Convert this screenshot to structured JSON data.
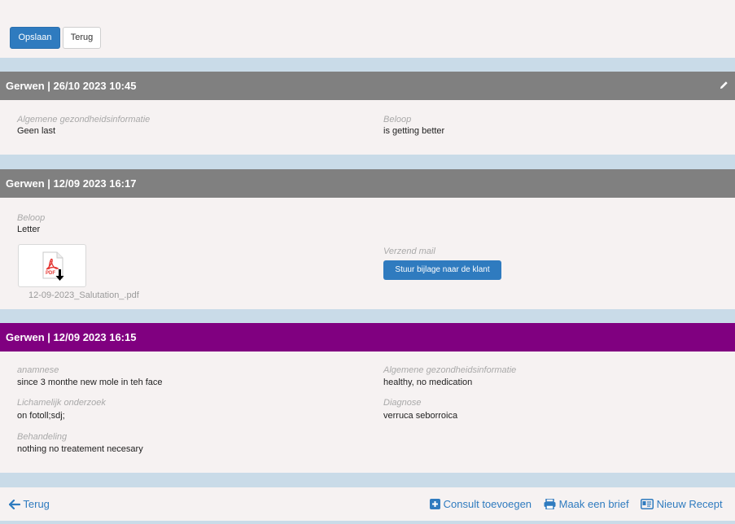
{
  "toolbar": {
    "save_label": "Opslaan",
    "back_label": "Terug"
  },
  "entries": [
    {
      "header": "Gerwen | 26/10 2023 10:45",
      "fields": [
        {
          "label": "Algemene gezondheidsinformatie",
          "value": "Geen last"
        },
        {
          "label": "Beloop",
          "value": "is getting better"
        }
      ]
    },
    {
      "header": "Gerwen | 12/09 2023 16:17",
      "fields": [
        {
          "label": "Beloop",
          "value": "Letter"
        },
        {
          "label": "Verzend mail",
          "value": ""
        }
      ],
      "attachment": {
        "file_name": "12-09-2023_Salutation_.pdf",
        "icon_text": "PDF",
        "icon": "pdf-download-icon"
      },
      "send_button_label": "Stuur bijlage naar de klant"
    },
    {
      "header": "Gerwen | 12/09 2023 16:15",
      "fields": [
        {
          "label": "anamnese",
          "value": "since 3 monthe new mole in teh face"
        },
        {
          "label": "Algemene gezondheidsinformatie",
          "value": "healthy, no medication"
        },
        {
          "label": "Lichamelijk onderzoek",
          "value": "on fotoll;sdj;"
        },
        {
          "label": "Diagnose",
          "value": "verruca seborroica"
        },
        {
          "label": "Behandeling",
          "value": "nothing no treatement necesary"
        }
      ]
    }
  ],
  "footer": {
    "back_label": "Terug",
    "add_consult_label": "Consult toevoegen",
    "make_letter_label": "Maak een brief",
    "new_recipe_label": "Nieuw Recept"
  },
  "colors": {
    "primary": "#2f7bbf",
    "header_grey": "#808080",
    "header_purple": "#800080",
    "panel": "#f6f2f2",
    "background": "#c9dbe8"
  }
}
